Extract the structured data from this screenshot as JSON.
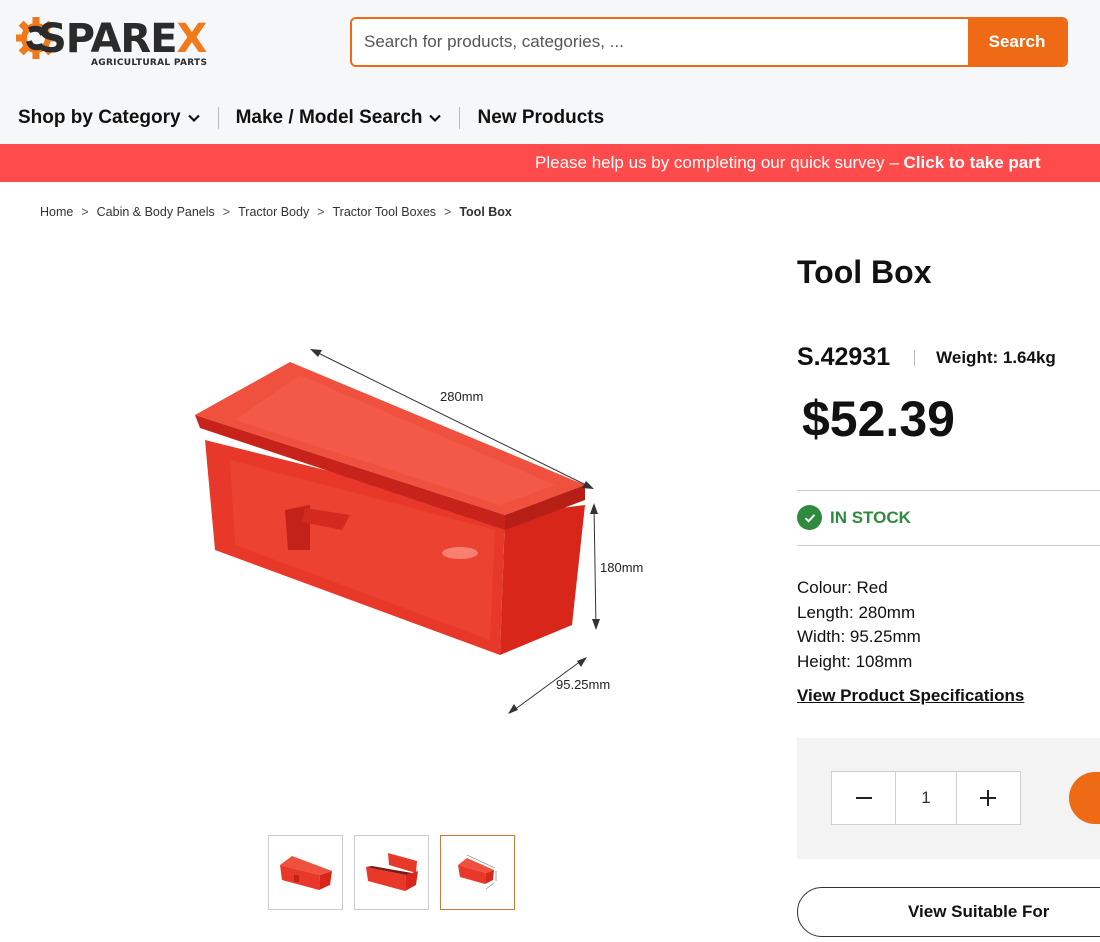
{
  "header": {
    "logo": {
      "text_main": "SPARE",
      "text_x": "X",
      "subtitle": "AGRICULTURAL PARTS"
    },
    "search": {
      "placeholder": "Search for products, categories, ...",
      "button_label": "Search"
    },
    "nav": [
      {
        "label": "Shop by Category",
        "has_dropdown": true
      },
      {
        "label": "Make / Model Search",
        "has_dropdown": true
      },
      {
        "label": "New Products",
        "has_dropdown": false
      }
    ]
  },
  "survey_banner": {
    "text": "Please help us by completing our quick survey – ",
    "link": "Click to take part"
  },
  "breadcrumb": [
    "Home",
    "Cabin & Body Panels",
    "Tractor Body",
    "Tractor Tool Boxes",
    "Tool Box"
  ],
  "product": {
    "title": "Tool Box",
    "sku": "S.42931",
    "weight": "Weight: 1.64kg",
    "price": "$52.39",
    "stock": "IN STOCK",
    "specs": [
      "Colour: Red",
      "Length: 280mm",
      "Width: 95.25mm",
      "Height: 108mm"
    ],
    "spec_link": "View Product Specifications",
    "quantity": "1",
    "suitable_button": "View Suitable For",
    "image_dimensions": {
      "length": "280mm",
      "height": "180mm",
      "width": "95.25mm"
    },
    "thumbnails_count": 3,
    "active_thumbnail": 3
  },
  "colors": {
    "accent": "#ee6a15",
    "banner": "#ff4b4b",
    "in_stock": "#2e8b3e",
    "product_red": "#e8382a"
  },
  "icons": {
    "nav_dropdown": "chevron-down-icon",
    "stock": "check-circle-icon",
    "qty_minus": "minus-icon",
    "qty_plus": "plus-icon"
  }
}
